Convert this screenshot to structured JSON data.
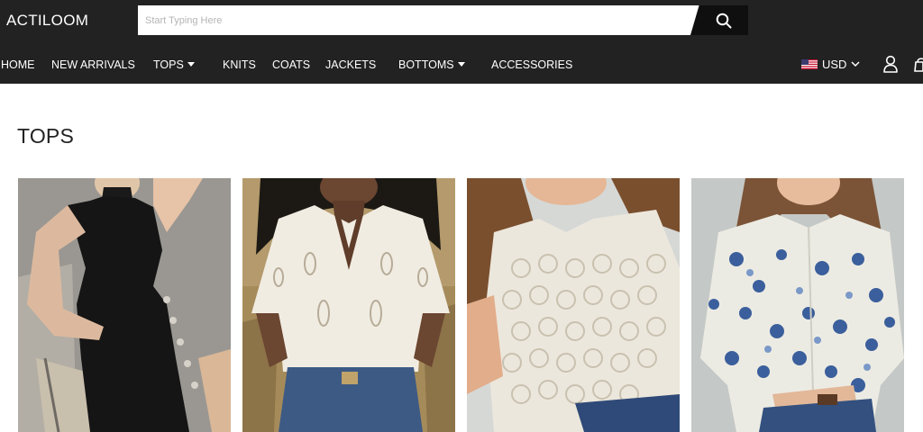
{
  "brand": {
    "logo": "ACTILOOM"
  },
  "search": {
    "placeholder": "Start Typing Here",
    "value": "",
    "button_icon": "search-icon"
  },
  "nav": {
    "items": [
      {
        "label": "HOME",
        "dropdown": false
      },
      {
        "label": "NEW ARRIVALS",
        "dropdown": false
      },
      {
        "label": "TOPS",
        "dropdown": true
      },
      {
        "label": "KNITS",
        "dropdown": false
      },
      {
        "label": "COATS",
        "dropdown": false
      },
      {
        "label": "JACKETS",
        "dropdown": false
      },
      {
        "label": "BOTTOMS",
        "dropdown": true
      },
      {
        "label": "ACCESSORIES",
        "dropdown": false
      }
    ]
  },
  "currency": {
    "label": "USD",
    "flag_icon": "us-flag-icon"
  },
  "header_icons": [
    "user-icon",
    "cart-icon"
  ],
  "page": {
    "title": "TOPS"
  },
  "products": [
    {
      "image": "black-sleeveless-knit-dress-photo"
    },
    {
      "image": "white-eyelet-blouse-photo"
    },
    {
      "image": "white-lace-top-photo"
    },
    {
      "image": "blue-floral-print-shirt-photo"
    }
  ],
  "colors": {
    "header_bg": "#222222",
    "search_button_bg": "#0f0f0f",
    "header_text": "#ffffff",
    "page_bg": "#ffffff"
  }
}
